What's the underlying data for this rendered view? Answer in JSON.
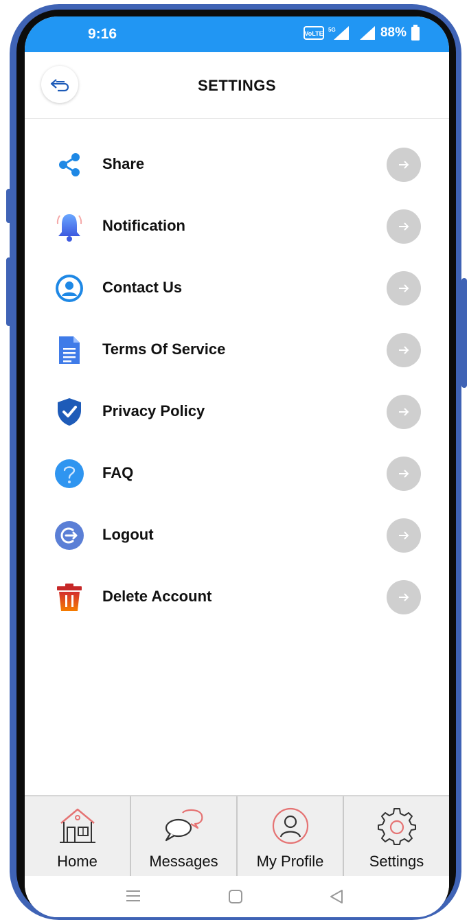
{
  "status_bar": {
    "time": "9:16",
    "battery": "88%"
  },
  "header": {
    "title": "SETTINGS",
    "back_icon": "back-arrow-icon"
  },
  "menu": {
    "items": [
      {
        "label": "Share",
        "icon": "share-icon"
      },
      {
        "label": "Notification",
        "icon": "bell-icon"
      },
      {
        "label": "Contact Us",
        "icon": "contact-person-icon"
      },
      {
        "label": "Terms Of Service",
        "icon": "document-icon"
      },
      {
        "label": "Privacy Policy",
        "icon": "shield-check-icon"
      },
      {
        "label": "FAQ",
        "icon": "question-icon"
      },
      {
        "label": "Logout",
        "icon": "logout-icon"
      },
      {
        "label": "Delete Account",
        "icon": "trash-icon"
      }
    ],
    "arrow_icon": "arrow-right-icon"
  },
  "bottom_nav": {
    "items": [
      {
        "label": "Home",
        "icon": "house-icon"
      },
      {
        "label": "Messages",
        "icon": "chat-bubbles-icon"
      },
      {
        "label": "My Profile",
        "icon": "profile-icon"
      },
      {
        "label": "Settings",
        "icon": "gear-icon"
      }
    ]
  },
  "colors": {
    "status_bar": "#2196f3",
    "frame": "#3f63b5",
    "accent": "#e57373",
    "arrow_button": "#cfcfcf"
  }
}
